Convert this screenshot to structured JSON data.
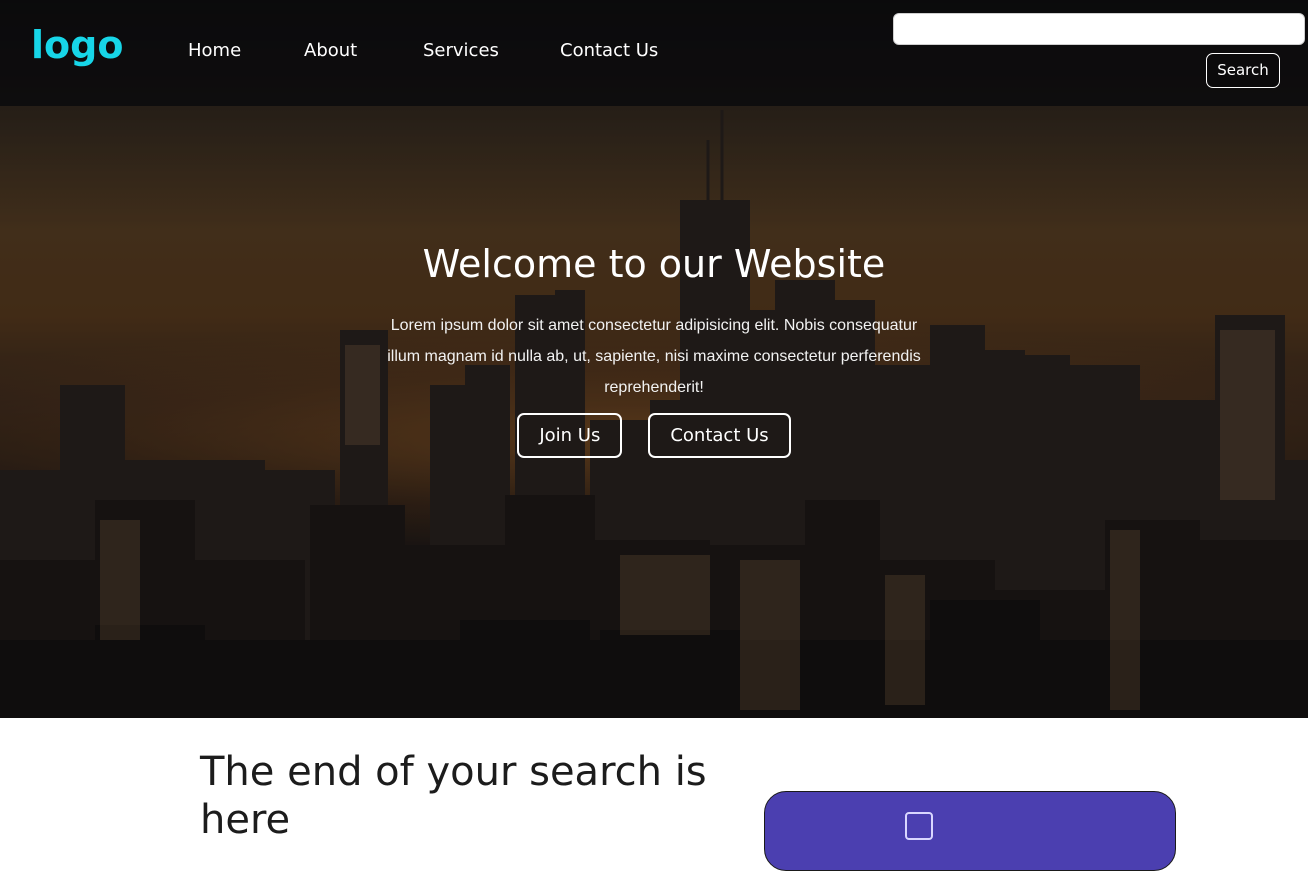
{
  "navbar": {
    "logo": "logo",
    "links": [
      "Home",
      "About",
      "Services",
      "Contact Us"
    ],
    "search": {
      "value": "",
      "placeholder": "",
      "button_label": "Search"
    }
  },
  "hero": {
    "title": "Welcome to our Website",
    "text": "Lorem ipsum dolor sit amet consectetur adipisicing elit. Nobis consequatur illum magnam id nulla ab, ut, sapiente, nisi maxime consectetur perferendis reprehenderit!",
    "buttons": [
      "Join Us",
      "Contact Us"
    ]
  },
  "section": {
    "title": "The end of your search is here"
  },
  "colors": {
    "logo": "#17d6e8",
    "card": "#4b3fb0"
  }
}
